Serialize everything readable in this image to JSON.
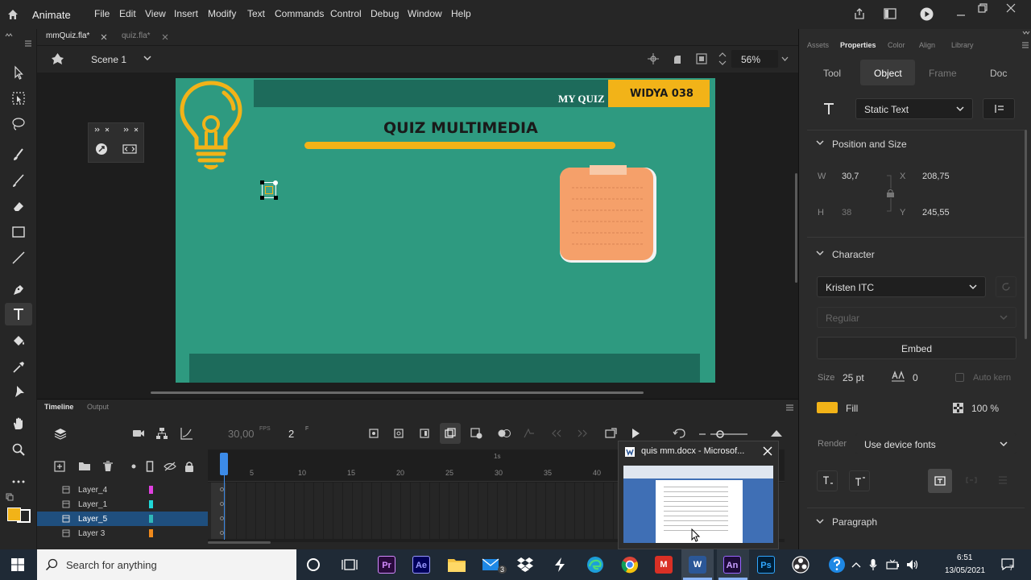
{
  "app": {
    "name": "Animate"
  },
  "menu": [
    "File",
    "Edit",
    "View",
    "Insert",
    "Modify",
    "Text",
    "Commands",
    "Control",
    "Debug",
    "Window",
    "Help"
  ],
  "doc_tabs": [
    {
      "label": "mmQuiz.fla*",
      "active": true
    },
    {
      "label": "quiz.fla*",
      "active": false
    }
  ],
  "scene": {
    "label": "Scene 1",
    "zoom": "56%"
  },
  "stage": {
    "my_quiz": "MY QUIZ",
    "author": "WIDYA 038",
    "title": "QUIZ MULTIMEDIA"
  },
  "timeline": {
    "tabs": [
      "Timeline",
      "Output"
    ],
    "fps": "30,00",
    "fps_unit": "FPS",
    "frame": "2",
    "frame_unit": "F",
    "ruler_marker": "1s",
    "frame_numbers": [
      "5",
      "10",
      "15",
      "20",
      "25",
      "30",
      "35",
      "40"
    ],
    "layers": [
      {
        "name": "Layer_4",
        "color": "#e040e0",
        "selected": false
      },
      {
        "name": "Layer_1",
        "color": "#20d8d8",
        "selected": false
      },
      {
        "name": "Layer_5",
        "color": "#2fb8b8",
        "selected": true
      },
      {
        "name": "Layer 3",
        "color": "#f08a1c",
        "selected": false
      }
    ]
  },
  "thumbnail_popup": {
    "title": "quis mm.docx - Microsof..."
  },
  "properties": {
    "panel_tabs": [
      "Assets",
      "Properties",
      "Color",
      "Align",
      "Library"
    ],
    "segments": [
      "Tool",
      "Object",
      "Frame",
      "Doc"
    ],
    "text_type": "Static Text",
    "position_size": {
      "title": "Position and Size",
      "w_label": "W",
      "w": "30,7",
      "x_label": "X",
      "x": "208,75",
      "h_label": "H",
      "h": "38",
      "y_label": "Y",
      "y": "245,55"
    },
    "character": {
      "title": "Character",
      "font": "Kristen ITC",
      "style": "Regular",
      "embed": "Embed",
      "size_label": "Size",
      "size": "25 pt",
      "tracking": "0",
      "auto_kern": "Auto kern",
      "fill_label": "Fill",
      "fill_color": "#f2b318",
      "alpha": "100 %",
      "render_label": "Render",
      "render": "Use device fonts"
    },
    "paragraph": {
      "title": "Paragraph"
    }
  },
  "taskbar": {
    "search_placeholder": "Search for anything",
    "time": "6:51",
    "date": "13/05/2021",
    "notification_count": "7",
    "mail_badge": "3"
  }
}
